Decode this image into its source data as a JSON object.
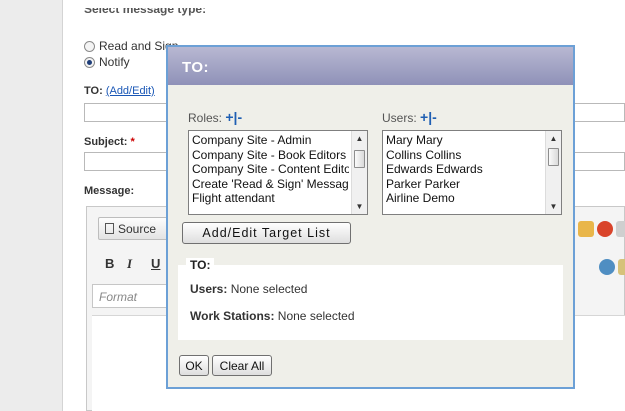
{
  "form": {
    "message_type_label": "Select message type:",
    "options": [
      {
        "label": "Read and Sign",
        "checked": false
      },
      {
        "label": "Notify",
        "checked": true
      }
    ],
    "to_label": "TO:",
    "to_link": "(Add/Edit)",
    "subject_label": "Subject:",
    "required_mark": "*",
    "message_label": "Message:"
  },
  "editor": {
    "source_label": "Source",
    "bold": "B",
    "italic": "I",
    "underline": "U",
    "format_placeholder": "Format"
  },
  "dialog": {
    "title": "TO:",
    "roles": {
      "label": "Roles:",
      "plus": "+",
      "sep": "|",
      "minus": "-",
      "items": [
        "Company Site - Admin",
        "Company Site - Book Editors",
        "Company Site - Content Editors",
        "Create 'Read & Sign' Messages",
        "Flight attendant"
      ]
    },
    "users": {
      "label": "Users:",
      "plus": "+",
      "sep": "|",
      "minus": "-",
      "items": [
        "Mary Mary",
        "Collins Collins",
        "Edwards Edwards",
        "Parker Parker",
        "Airline Demo"
      ]
    },
    "add_edit_button": "Add/Edit Target List",
    "to_panel": {
      "heading": "TO:",
      "users_label": "Users:",
      "users_value": "None selected",
      "workstations_label": "Work Stations:",
      "workstations_value": "None selected"
    },
    "ok_button": "OK",
    "clear_button": "Clear All"
  },
  "colors": {
    "dialog_border": "#6ca0d6",
    "dialog_header": "#8f91b8",
    "link": "#1a57b6",
    "required": "#cc0000"
  }
}
